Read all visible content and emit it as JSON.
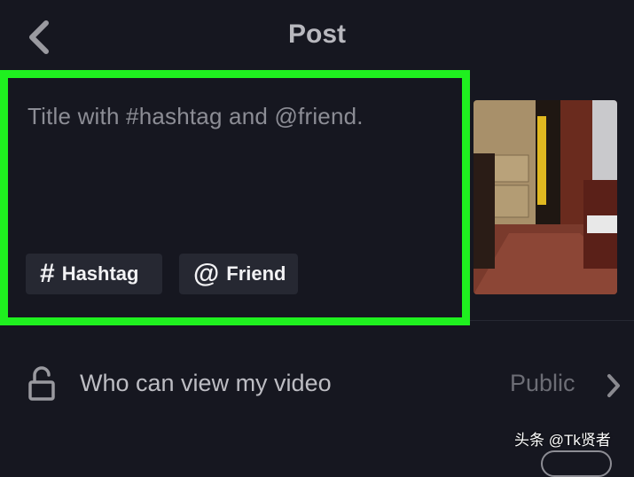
{
  "header": {
    "title": "Post",
    "back_icon": "chevron-left-icon"
  },
  "caption": {
    "placeholder": "Title with #hashtag and @friend.",
    "hashtag_chip": {
      "icon": "#",
      "label": "Hashtag"
    },
    "friend_chip": {
      "icon": "@",
      "label": "Friend"
    },
    "highlight_color": "#1ff01f"
  },
  "privacy": {
    "icon": "unlock-icon",
    "label": "Who can view my video",
    "value": "Public",
    "chevron_icon": "chevron-right-icon"
  },
  "watermark": {
    "text": "头条 @Tk贤者"
  }
}
